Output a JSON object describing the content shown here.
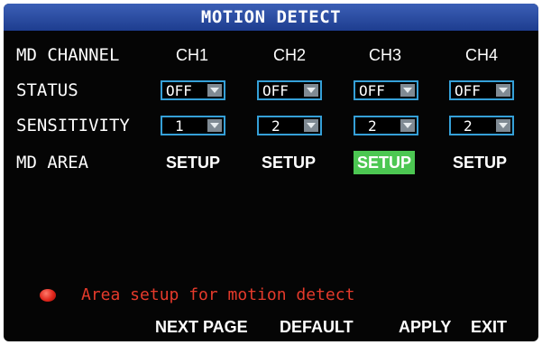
{
  "title": "MOTION DETECT",
  "rows": {
    "md_channel": {
      "label": "MD CHANNEL",
      "channels": [
        "CH1",
        "CH2",
        "CH3",
        "CH4"
      ]
    },
    "status": {
      "label": "STATUS",
      "values": [
        "OFF",
        "OFF",
        "OFF",
        "OFF"
      ]
    },
    "sensitivity": {
      "label": "SENSITIVITY",
      "values": [
        "1",
        "2",
        "2",
        "2"
      ]
    },
    "md_area": {
      "label": "MD AREA",
      "buttons": [
        "SETUP",
        "SETUP",
        "SETUP",
        "SETUP"
      ],
      "selected_index": 2
    }
  },
  "hint": "Area setup for motion detect",
  "footer": {
    "next_page": "NEXT PAGE",
    "default": "DEFAULT",
    "apply": "APPLY",
    "exit": "EXIT"
  },
  "colors": {
    "title_bar": "#2a4ea8",
    "dropdown_border": "#35a0d8",
    "selected_button": "#4cc752",
    "hint_text": "#e53a2b",
    "indicator": "#e0261c"
  },
  "icons": {
    "dropdown_arrow": "chevron-down-icon",
    "indicator": "red-dot-icon"
  }
}
